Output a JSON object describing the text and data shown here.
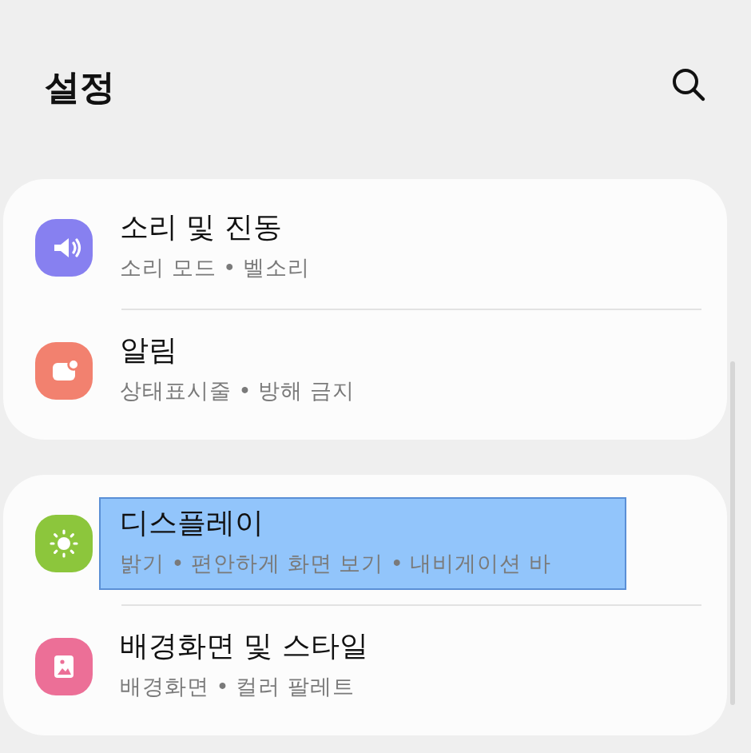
{
  "header": {
    "title": "설정"
  },
  "groups": [
    {
      "items": [
        {
          "kind": "sound",
          "title": "소리 및 진동",
          "subtitle": "소리 모드 • 벨소리",
          "color": "#8780f0",
          "highlighted": false
        },
        {
          "kind": "notifications",
          "title": "알림",
          "subtitle": "상태표시줄 • 방해 금지",
          "color": "#f2816f",
          "highlighted": false
        }
      ]
    },
    {
      "items": [
        {
          "kind": "display",
          "title": "디스플레이",
          "subtitle": "밝기 • 편안하게 화면 보기 • 내비게이션 바",
          "color": "#8cc63c",
          "highlighted": true
        },
        {
          "kind": "wallpaper",
          "title": "배경화면 및 스타일",
          "subtitle": "배경화면 • 컬러 팔레트",
          "color": "#ec6f97",
          "highlighted": false
        }
      ]
    }
  ]
}
